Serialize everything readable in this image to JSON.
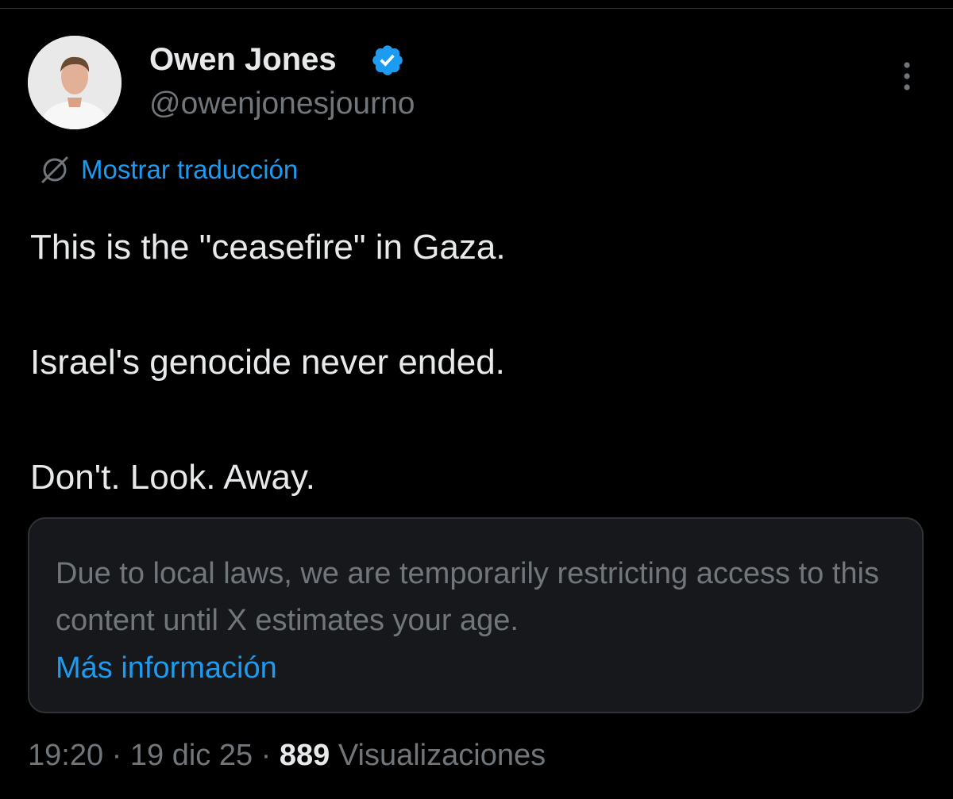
{
  "author": {
    "name": "Owen Jones",
    "handle": "@owenjonesjourno",
    "verified": true,
    "avatar_icon": "profile-photo"
  },
  "translate": {
    "icon": "translate-icon",
    "label": "Mostrar traducción"
  },
  "tweet": {
    "lines": [
      "This is the \"ceasefire\" in Gaza.",
      "Israel's genocide never ended.",
      "Don't. Look. Away."
    ]
  },
  "notice": {
    "text": "Due to local laws, we are temporarily restricting access to this content until X estimates your age.",
    "link": "Más información"
  },
  "meta": {
    "time": "19:20",
    "separator": "·",
    "date": "19 dic 25",
    "views_count": "889",
    "views_label": "Visualizaciones"
  },
  "colors": {
    "background": "#000000",
    "text_primary": "#e7e9ea",
    "text_secondary": "#71767b",
    "accent": "#1d9bf0",
    "notice_background": "#16181c",
    "border": "#2f3336"
  }
}
